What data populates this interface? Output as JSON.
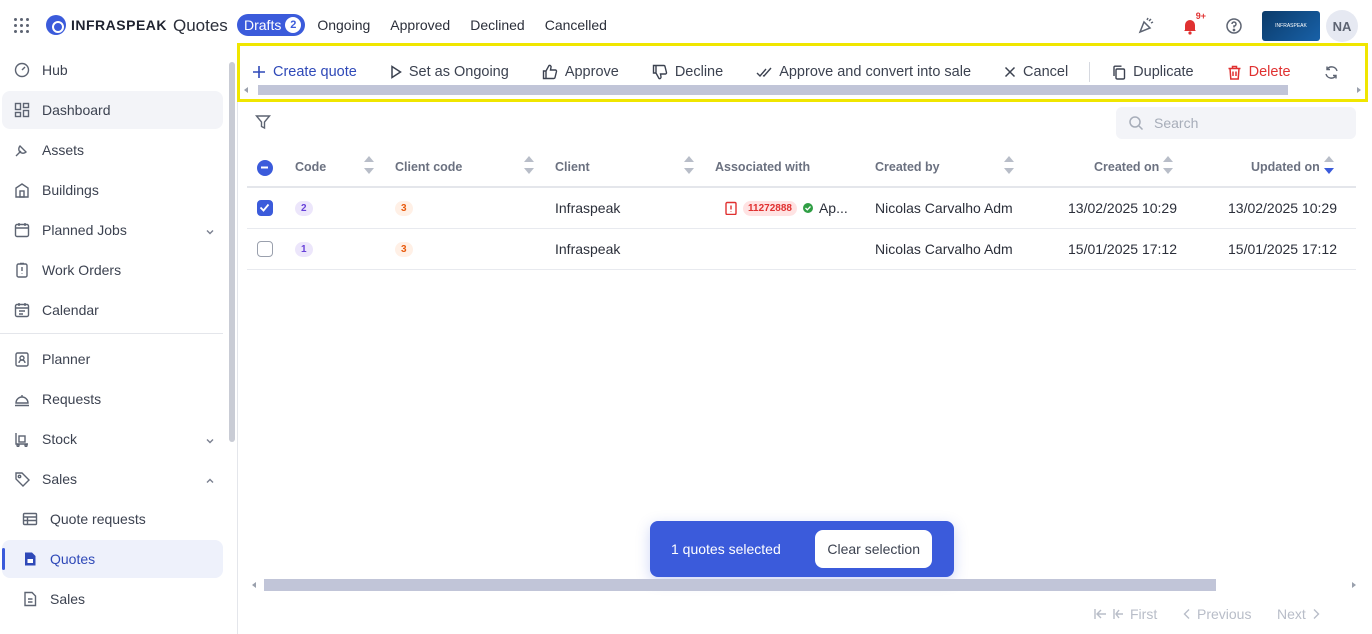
{
  "app": {
    "logo_text": "INFRASPEAK",
    "page_title": "Quotes",
    "tabs": [
      {
        "label": "Drafts",
        "count": "2"
      },
      {
        "label": "Ongoing"
      },
      {
        "label": "Approved"
      },
      {
        "label": "Declined"
      },
      {
        "label": "Cancelled"
      }
    ],
    "notification_badge": "9+",
    "company_logo_text": "INFRASPEAK",
    "avatar_initials": "NA"
  },
  "sidebar": {
    "items": [
      {
        "label": "Hub",
        "icon": "hub-icon"
      },
      {
        "label": "Dashboard",
        "icon": "dashboard-icon"
      },
      {
        "label": "Assets",
        "icon": "assets-icon"
      },
      {
        "label": "Buildings",
        "icon": "buildings-icon"
      },
      {
        "label": "Planned Jobs",
        "icon": "planned-jobs-icon"
      },
      {
        "label": "Work Orders",
        "icon": "work-orders-icon"
      },
      {
        "label": "Calendar",
        "icon": "calendar-icon"
      },
      {
        "label": "Planner",
        "icon": "planner-icon"
      },
      {
        "label": "Requests",
        "icon": "requests-icon"
      },
      {
        "label": "Stock",
        "icon": "stock-icon"
      },
      {
        "label": "Sales",
        "icon": "sales-icon"
      },
      {
        "label": "Quote requests",
        "icon": "quote-requests-icon"
      },
      {
        "label": "Quotes",
        "icon": "quotes-icon"
      },
      {
        "label": "Sales",
        "icon": "sales-doc-icon"
      }
    ]
  },
  "actions": {
    "create": "Create quote",
    "set_ongoing": "Set as Ongoing",
    "approve": "Approve",
    "decline": "Decline",
    "approve_convert": "Approve and convert into sale",
    "cancel": "Cancel",
    "duplicate": "Duplicate",
    "delete": "Delete"
  },
  "search": {
    "placeholder": "Search"
  },
  "table": {
    "columns": [
      "Code",
      "Client code",
      "Client",
      "Associated with",
      "Created by",
      "Created on",
      "Updated on"
    ],
    "rows": [
      {
        "code": "2",
        "client_code": "3",
        "client": "Infraspeak",
        "assoc_id": "11272888",
        "assoc_status": "Ap...",
        "created_by": "Nicolas Carvalho Adm",
        "created_on": "13/02/2025 10:29",
        "updated_on": "13/02/2025 10:29",
        "selected": true
      },
      {
        "code": "1",
        "client_code": "3",
        "client": "Infraspeak",
        "assoc_id": "",
        "assoc_status": "",
        "created_by": "Nicolas Carvalho Adm",
        "created_on": "15/01/2025 17:12",
        "updated_on": "15/01/2025 17:12",
        "selected": false
      }
    ]
  },
  "selection": {
    "text": "1 quotes selected",
    "clear": "Clear selection"
  },
  "pagination": {
    "first": "First",
    "previous": "Previous",
    "next": "Next"
  },
  "colors": {
    "accent": "#3b5bdb",
    "danger": "#e03131",
    "highlight_border": "#f0e600"
  }
}
